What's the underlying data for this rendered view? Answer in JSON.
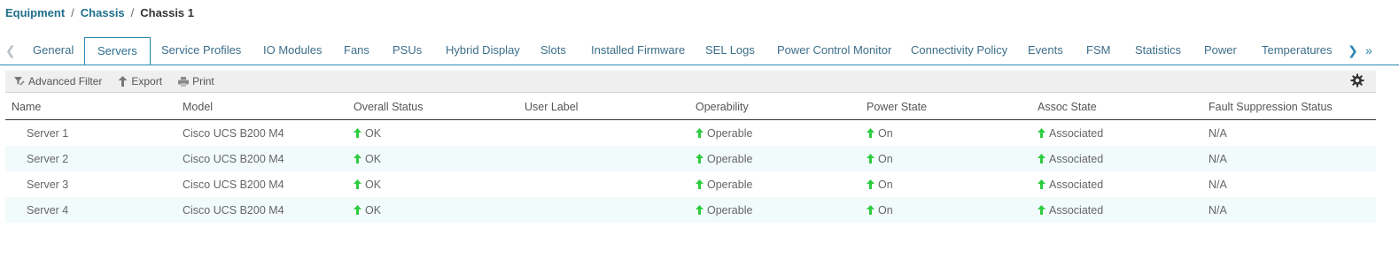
{
  "breadcrumb": {
    "items": [
      "Equipment",
      "Chassis"
    ],
    "separator": "/",
    "current": "Chassis 1"
  },
  "tabs": {
    "items": [
      "General",
      "Servers",
      "Service Profiles",
      "IO Modules",
      "Fans",
      "PSUs",
      "Hybrid Display",
      "Slots",
      "Installed Firmware",
      "SEL Logs",
      "Power Control Monitor",
      "Connectivity Policy",
      "Events",
      "FSM",
      "Statistics",
      "Power",
      "Temperatures"
    ],
    "active": "Servers"
  },
  "toolbar": {
    "advanced_filter": "Advanced Filter",
    "export": "Export",
    "print": "Print"
  },
  "table": {
    "columns": [
      "Name",
      "Model",
      "Overall Status",
      "User Label",
      "Operability",
      "Power State",
      "Assoc State",
      "Fault Suppression Status"
    ],
    "rows": [
      {
        "name": "Server 1",
        "model": "Cisco UCS B200 M4",
        "overall_status": "OK",
        "user_label": "",
        "operability": "Operable",
        "power_state": "On",
        "assoc_state": "Associated",
        "fault_suppression": "N/A"
      },
      {
        "name": "Server 2",
        "model": "Cisco UCS B200 M4",
        "overall_status": "OK",
        "user_label": "",
        "operability": "Operable",
        "power_state": "On",
        "assoc_state": "Associated",
        "fault_suppression": "N/A"
      },
      {
        "name": "Server 3",
        "model": "Cisco UCS B200 M4",
        "overall_status": "OK",
        "user_label": "",
        "operability": "Operable",
        "power_state": "On",
        "assoc_state": "Associated",
        "fault_suppression": "N/A"
      },
      {
        "name": "Server 4",
        "model": "Cisco UCS B200 M4",
        "overall_status": "OK",
        "user_label": "",
        "operability": "Operable",
        "power_state": "On",
        "assoc_state": "Associated",
        "fault_suppression": "N/A"
      }
    ]
  },
  "colors": {
    "link": "#1f6f8b",
    "accent": "#2a87b0",
    "status_ok": "#2ecc40",
    "row_alt": "#f2fbfc"
  },
  "icons": {
    "status": "up-arrow-icon",
    "filter": "filter-icon",
    "export": "export-icon",
    "print": "print-icon",
    "settings": "gear-icon"
  }
}
